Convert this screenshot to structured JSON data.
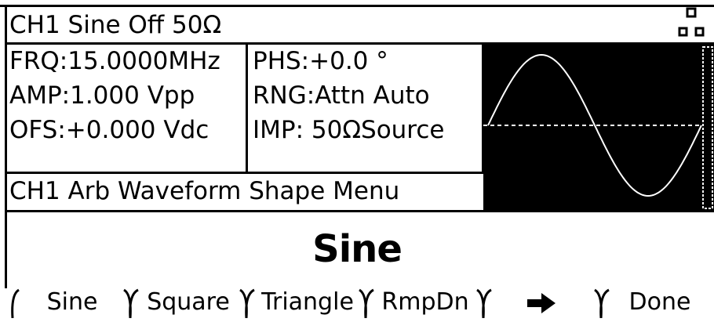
{
  "status_bar": {
    "text": "CH1   Sine Off 50Ω",
    "indicator_icon": "channel-status-icon"
  },
  "parameters": {
    "frequency": "FRQ:15.0000MHz",
    "amplitude": "AMP:1.000 Vpp",
    "offset": "OFS:+0.000 Vdc",
    "phase": "PHS:+0.0 °",
    "range": "RNG:Attn Auto",
    "impedance": "IMP: 50ΩSource"
  },
  "waveform_preview": {
    "shape": "sine",
    "background": "#000000",
    "trace_color": "#ffffff"
  },
  "menu": {
    "title": "CH1 Arb Waveform Shape Menu",
    "selected_shape": "Sine"
  },
  "softkeys": [
    {
      "label": "Sine"
    },
    {
      "label": "Square"
    },
    {
      "label": "Triangle"
    },
    {
      "label": "RmpDn"
    },
    {
      "label": "➡",
      "icon": "right-arrow-icon"
    },
    {
      "label": "Done"
    }
  ]
}
